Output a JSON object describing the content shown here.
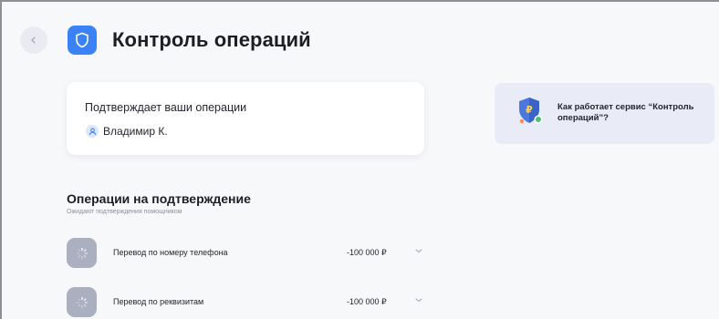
{
  "header": {
    "back_icon": "chevron-left-icon",
    "logo_icon": "shield-icon",
    "title": "Контроль операций",
    "accent_color": "#3b82f6"
  },
  "confirm_card": {
    "title": "Подтверждает ваши операции",
    "person_icon": "person-icon",
    "person_name": "Владимир К."
  },
  "info_card": {
    "illustration": "ruble-shield-icon",
    "text": "Как работает сервис “Контроль операций”?"
  },
  "operations": {
    "title": "Операции на подтверждение",
    "subtitle": "Ожидают  подтверждения помощником",
    "items": [
      {
        "icon": "loading-spinner-icon",
        "label": "Перевод по номеру телефона",
        "amount": "-100 000 ₽",
        "chevron": "chevron-down-icon"
      },
      {
        "icon": "loading-spinner-icon",
        "label": "Перевод по реквизитам",
        "amount": "-100 000 ₽",
        "chevron": "chevron-down-icon"
      }
    ]
  }
}
